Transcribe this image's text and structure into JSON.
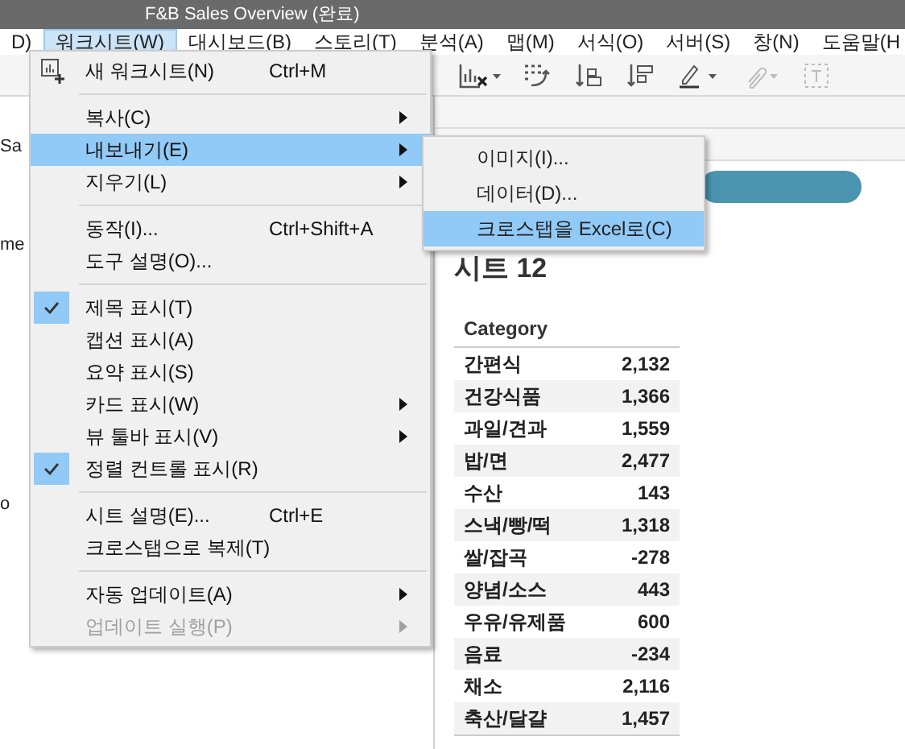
{
  "window": {
    "title": "F&B Sales Overview (완료)"
  },
  "menubar": [
    {
      "label": "D)",
      "selected": false
    },
    {
      "label": "워크시트(W)",
      "selected": true
    },
    {
      "label": "대시보드(B)",
      "selected": false
    },
    {
      "label": "스토리(T)",
      "selected": false
    },
    {
      "label": "분석(A)",
      "selected": false
    },
    {
      "label": "맵(M)",
      "selected": false
    },
    {
      "label": "서식(O)",
      "selected": false
    },
    {
      "label": "서버(S)",
      "selected": false
    },
    {
      "label": "창(N)",
      "selected": false
    },
    {
      "label": "도움말(H",
      "selected": false
    }
  ],
  "menu": [
    {
      "kind": "item",
      "label": "새 워크시트(N)",
      "shortcut": "Ctrl+M",
      "icon": true,
      "checked": false,
      "submenu": false,
      "disabled": false,
      "selected": false
    },
    {
      "kind": "separator"
    },
    {
      "kind": "item",
      "label": "복사(C)",
      "checked": false,
      "submenu": true,
      "disabled": false,
      "selected": false
    },
    {
      "kind": "item",
      "label": "내보내기(E)",
      "checked": false,
      "submenu": true,
      "disabled": false,
      "selected": true
    },
    {
      "kind": "item",
      "label": "지우기(L)",
      "checked": false,
      "submenu": true,
      "disabled": false,
      "selected": false
    },
    {
      "kind": "separator"
    },
    {
      "kind": "item",
      "label": "동작(I)...",
      "shortcut": "Ctrl+Shift+A",
      "checked": false,
      "submenu": false,
      "disabled": false,
      "selected": false
    },
    {
      "kind": "item",
      "label": "도구 설명(O)...",
      "checked": false,
      "submenu": false,
      "disabled": false,
      "selected": false
    },
    {
      "kind": "separator"
    },
    {
      "kind": "item",
      "label": "제목 표시(T)",
      "checked": true,
      "submenu": false,
      "disabled": false,
      "selected": false
    },
    {
      "kind": "item",
      "label": "캡션 표시(A)",
      "checked": false,
      "submenu": false,
      "disabled": false,
      "selected": false
    },
    {
      "kind": "item",
      "label": "요약 표시(S)",
      "checked": false,
      "submenu": false,
      "disabled": false,
      "selected": false
    },
    {
      "kind": "item",
      "label": "카드 표시(W)",
      "checked": false,
      "submenu": true,
      "disabled": false,
      "selected": false
    },
    {
      "kind": "item",
      "label": "뷰 툴바 표시(V)",
      "checked": false,
      "submenu": true,
      "disabled": false,
      "selected": false
    },
    {
      "kind": "item",
      "label": "정렬 컨트롤 표시(R)",
      "checked": true,
      "submenu": false,
      "disabled": false,
      "selected": false
    },
    {
      "kind": "separator"
    },
    {
      "kind": "item",
      "label": "시트 설명(E)...",
      "shortcut": "Ctrl+E",
      "checked": false,
      "submenu": false,
      "disabled": false,
      "selected": false
    },
    {
      "kind": "item",
      "label": "크로스탭으로 복제(T)",
      "checked": false,
      "submenu": false,
      "disabled": false,
      "selected": false
    },
    {
      "kind": "separator"
    },
    {
      "kind": "item",
      "label": "자동 업데이트(A)",
      "checked": false,
      "submenu": true,
      "disabled": false,
      "selected": false
    },
    {
      "kind": "item",
      "label": "업데이트 실행(P)",
      "checked": false,
      "submenu": true,
      "disabled": true,
      "selected": false
    }
  ],
  "submenu": [
    {
      "label": "이미지(I)...",
      "selected": false
    },
    {
      "label": "데이터(D)...",
      "selected": false
    },
    {
      "label": "크로스탭을 Excel로(C)",
      "selected": true
    }
  ],
  "left_pane": [
    "Sa",
    "me",
    "o"
  ],
  "sheet": {
    "title": "시트 12",
    "column": "Category",
    "rows": [
      {
        "category": "간편식",
        "value": "2,132"
      },
      {
        "category": "건강식품",
        "value": "1,366"
      },
      {
        "category": "과일/견과",
        "value": "1,559"
      },
      {
        "category": "밥/면",
        "value": "2,477"
      },
      {
        "category": "수산",
        "value": "143"
      },
      {
        "category": "스낵/빵/떡",
        "value": "1,318"
      },
      {
        "category": "쌀/잡곡",
        "value": "-278"
      },
      {
        "category": "양념/소스",
        "value": "443"
      },
      {
        "category": "우유/유제품",
        "value": "600"
      },
      {
        "category": "음료",
        "value": "-234"
      },
      {
        "category": "채소",
        "value": "2,116"
      },
      {
        "category": "축산/달걀",
        "value": "1,457"
      }
    ]
  }
}
